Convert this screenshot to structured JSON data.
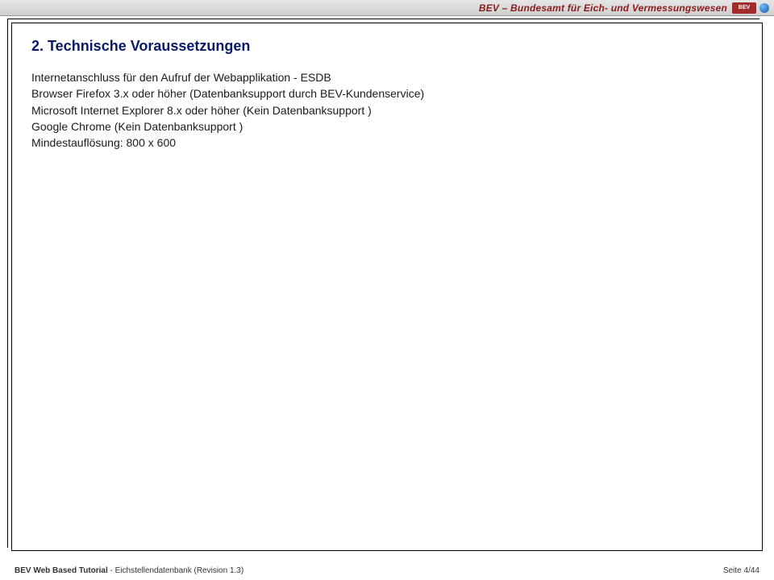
{
  "header": {
    "org_title": "BEV – Bundesamt für Eich- und Vermessungswesen",
    "logo_text": "BEV"
  },
  "content": {
    "heading": "2. Technische Voraussetzungen",
    "lines": [
      "Internetanschluss für den Aufruf der Webapplikation - ESDB",
      "Browser Firefox 3.x oder höher  (Datenbanksupport durch BEV-Kundenservice)",
      "Microsoft Internet Explorer 8.x oder höher (Kein Datenbanksupport )",
      "Google Chrome (Kein Datenbanksupport )",
      "Mindestauflösung: 800 x 600"
    ]
  },
  "footer": {
    "left_bold": "BEV Web Based Tutorial",
    "left_rest": " - Eichstellendatenbank (Revision 1.3)",
    "right": "Seite 4/44"
  }
}
